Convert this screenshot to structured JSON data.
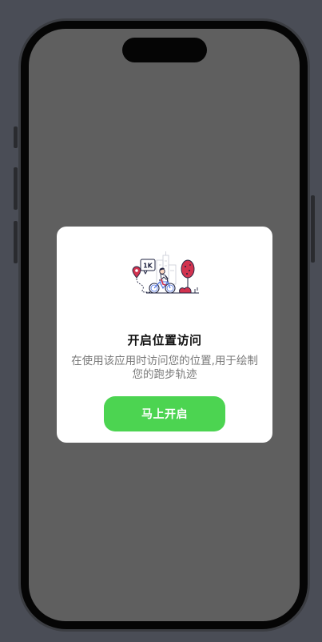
{
  "dialog": {
    "title": "开启位置访问",
    "description": "在使用该应用时访问您的位置,用于绘制您的跑步轨迹",
    "button_label": "马上开启",
    "illustration_badge": "1K",
    "illustration": "cyclist-map-illustration"
  },
  "colors": {
    "accent": "#4cd451",
    "screen_bg": "#5f5f5f",
    "desktop_bg": "#4a4d56",
    "title": "#111111",
    "description": "#7a7a7a"
  }
}
